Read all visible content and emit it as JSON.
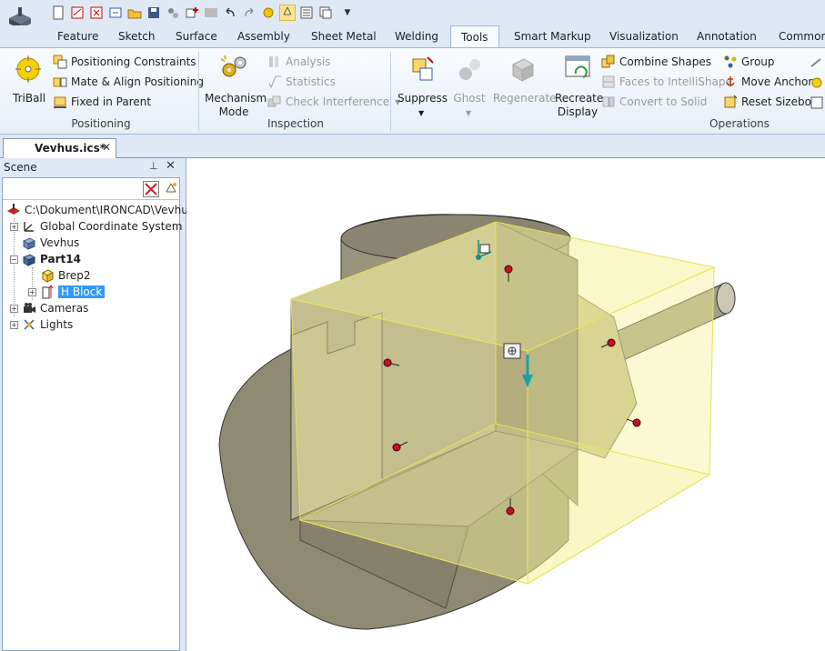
{
  "quick_access": {
    "icons": [
      "new-icon",
      "new-drawing-icon",
      "new-part-icon",
      "open-catalog-icon",
      "open-icon",
      "save-icon",
      "bom-icon",
      "add-icon",
      "catalog-browser-icon",
      "undo-icon",
      "redo-icon",
      "triball-quick-icon",
      "scene-browser-icon",
      "properties-icon",
      "window-icon"
    ]
  },
  "tabs": [
    {
      "label": "Feature"
    },
    {
      "label": "Sketch"
    },
    {
      "label": "Surface"
    },
    {
      "label": "Assembly"
    },
    {
      "label": "Sheet Metal"
    },
    {
      "label": "Welding"
    },
    {
      "label": "Tools"
    },
    {
      "label": "Smart Markup"
    },
    {
      "label": "Visualization"
    },
    {
      "label": "Annotation"
    },
    {
      "label": "Common"
    }
  ],
  "ribbon": {
    "positioning": {
      "label": "Positioning",
      "triball": "TriBall",
      "positioning_constraints": "Positioning Constraints",
      "mate_align": "Mate & Align Positioning",
      "fixed_in_parent": "Fixed in Parent"
    },
    "inspection": {
      "label": "Inspection",
      "mechanism_mode_line1": "Mechanism",
      "mechanism_mode_line2": "Mode",
      "analysis": "Analysis",
      "statistics": "Statistics",
      "check_interference": "Check Interference"
    },
    "operations": {
      "label": "Operations",
      "suppress": "Suppress",
      "ghost": "Ghost",
      "regenerate": "Regenerate",
      "recreate_line1": "Recreate",
      "recreate_line2": "Display",
      "combine_shapes": "Combine Shapes",
      "faces_to_intellishape": "Faces to IntelliShape",
      "convert_to_solid": "Convert to Solid",
      "group": "Group",
      "move_anchor": "Move Anchor",
      "reset_sizebox": "Reset Sizebox"
    }
  },
  "document": {
    "tab_label": "Vevhus.ics*",
    "close": "✕"
  },
  "scene": {
    "title": "Scene",
    "pin": "⊥",
    "close": "✕",
    "tree": [
      {
        "label": "C:\\Dokument\\IRONCAD\\Vevhus",
        "icon": "file-icon"
      },
      {
        "label": "Global Coordinate System",
        "icon": "axes-icon"
      },
      {
        "label": "Vevhus",
        "icon": "assembly-icon"
      },
      {
        "label": "Part14",
        "icon": "part-icon"
      },
      {
        "label": "Brep2",
        "icon": "brep-icon"
      },
      {
        "label": "H Block",
        "icon": "block-icon"
      },
      {
        "label": "Cameras",
        "icon": "camera-icon"
      },
      {
        "label": "Lights",
        "icon": "light-icon"
      }
    ]
  },
  "colors": {
    "ribbon_bg": "#e8eff8",
    "frame": "#dfe9f5",
    "selection": "#3399ff",
    "model_body": "#8f8a72",
    "sizebox": "#f4f29a",
    "handle_red": "#c8102e"
  }
}
